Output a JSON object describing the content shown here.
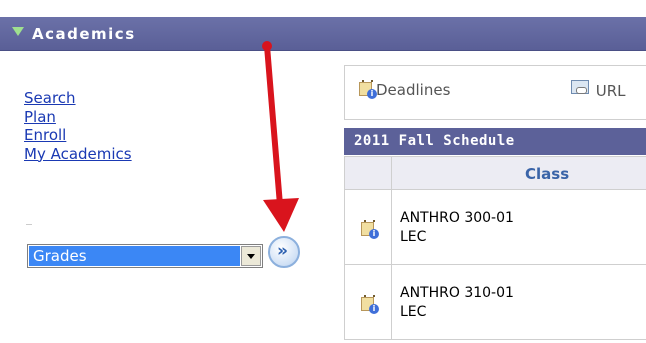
{
  "header": {
    "title": "Academics"
  },
  "nav": {
    "links": [
      "Search",
      "Plan",
      "Enroll",
      "My Academics"
    ]
  },
  "dropdown": {
    "selected": "Grades"
  },
  "toolbar": {
    "deadlines_label": "Deadlines",
    "url_label": "URL"
  },
  "schedule": {
    "title": "2011 Fall Schedule",
    "column_header": "Class",
    "rows": [
      {
        "course": "ANTHRO 300-01",
        "type": "LEC"
      },
      {
        "course": "ANTHRO 310-01",
        "type": "LEC"
      }
    ]
  },
  "colors": {
    "header_bg": "#5a5f97",
    "link": "#1a39b3",
    "dropdown_highlight": "#3b87f5",
    "annotation_arrow": "#d9141d",
    "column_header_text": "#3a64a8"
  },
  "icons": {
    "header": "collapse-triangle-icon",
    "go": "double-chevron-right-icon",
    "deadlines": "schedule-info-icon",
    "url": "url-link-icon",
    "row": "schedule-info-icon"
  }
}
